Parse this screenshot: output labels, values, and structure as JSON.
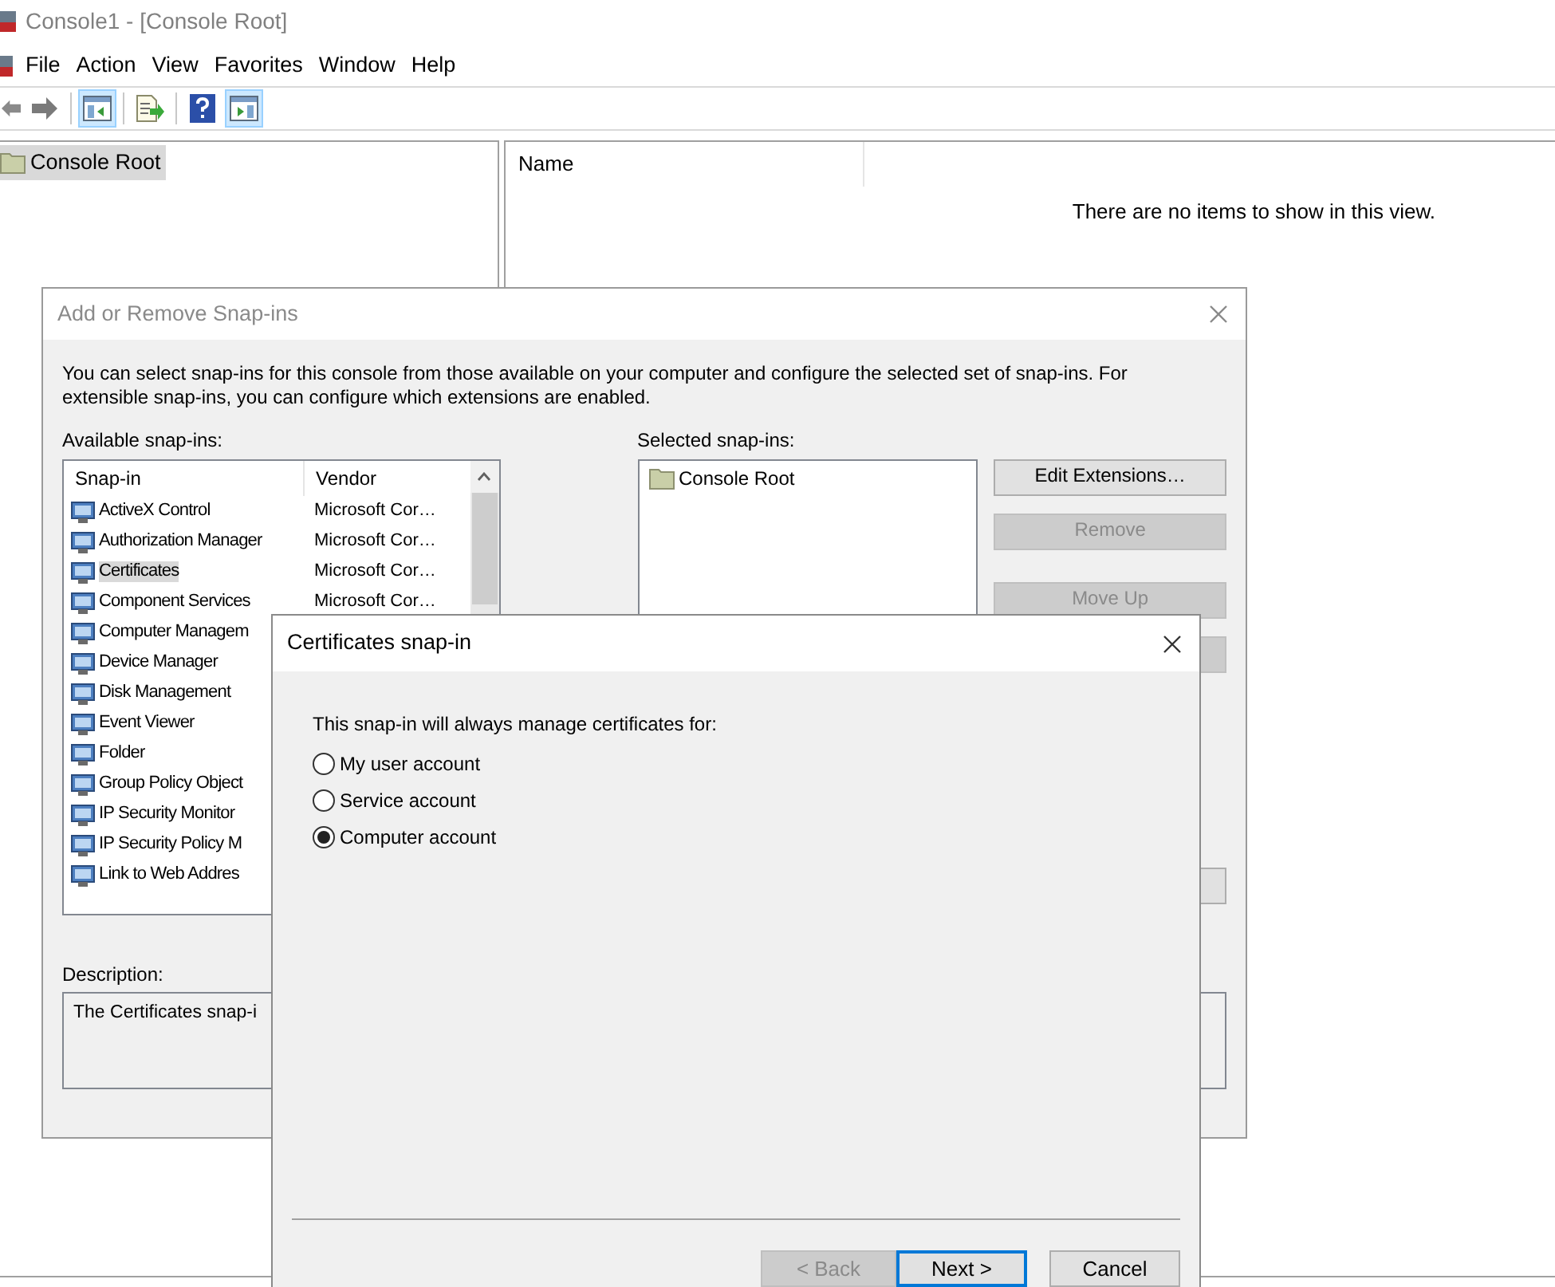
{
  "window": {
    "title": "Console1 - [Console Root]"
  },
  "menu": [
    "File",
    "Action",
    "View",
    "Favorites",
    "Window",
    "Help"
  ],
  "toolbar": [
    {
      "kind": "back",
      "pressed": false
    },
    {
      "kind": "forward",
      "pressed": false
    },
    {
      "kind": "tree",
      "pressed": true
    },
    {
      "kind": "export",
      "pressed": false
    },
    {
      "kind": "help",
      "pressed": false
    },
    {
      "kind": "actions",
      "pressed": true
    }
  ],
  "tree": {
    "items": [
      {
        "label": "Console Root",
        "selected": true
      }
    ]
  },
  "list_view": {
    "columns": [
      "Name"
    ],
    "empty_message": "There are no items to show in this view."
  },
  "snapin_dialog": {
    "title": "Add or Remove Snap-ins",
    "intro": "You can select snap-ins for this console from those available on your computer and configure the selected set of snap-ins. For extensible snap-ins, you can configure which extensions are enabled.",
    "available_label": "Available snap-ins:",
    "columns": [
      "Snap-in",
      "Vendor"
    ],
    "rows": [
      {
        "name": "ActiveX Control",
        "vendor": "Microsoft Cor…",
        "selected": false
      },
      {
        "name": "Authorization Manager",
        "vendor": "Microsoft Cor…",
        "selected": false
      },
      {
        "name": "Certificates",
        "vendor": "Microsoft Cor…",
        "selected": true
      },
      {
        "name": "Component Services",
        "vendor": "Microsoft Cor…",
        "selected": false
      },
      {
        "name": "Computer Managem",
        "selected": false
      },
      {
        "name": "Device Manager",
        "selected": false
      },
      {
        "name": "Disk Management",
        "selected": false
      },
      {
        "name": "Event Viewer",
        "selected": false
      },
      {
        "name": "Folder",
        "selected": false
      },
      {
        "name": "Group Policy Object",
        "selected": false
      },
      {
        "name": "IP Security Monitor",
        "selected": false
      },
      {
        "name": "IP Security Policy M",
        "selected": false
      },
      {
        "name": "Link to Web Addres",
        "selected": false
      }
    ],
    "selected_label": "Selected snap-ins:",
    "selected_items": [
      {
        "label": "Console Root"
      }
    ],
    "buttons": [
      {
        "label": "Edit Extensions…",
        "disabled": false
      },
      {
        "label": "Remove",
        "disabled": true
      },
      {
        "label": "Move Up",
        "disabled": true
      }
    ],
    "description_label": "Description:",
    "description": "The Certificates snap-i"
  },
  "cert_dialog": {
    "title": "Certificates snap-in",
    "prompt": "This snap-in will always manage certificates for:",
    "options": [
      {
        "label": "My user account",
        "selected": false
      },
      {
        "label": "Service account",
        "selected": false
      },
      {
        "label": "Computer account",
        "selected": true
      }
    ],
    "buttons": [
      {
        "label": "< Back",
        "disabled": true,
        "default": false
      },
      {
        "label": "Next >",
        "disabled": false,
        "default": true
      },
      {
        "label": "Cancel",
        "disabled": false,
        "default": false
      }
    ]
  }
}
